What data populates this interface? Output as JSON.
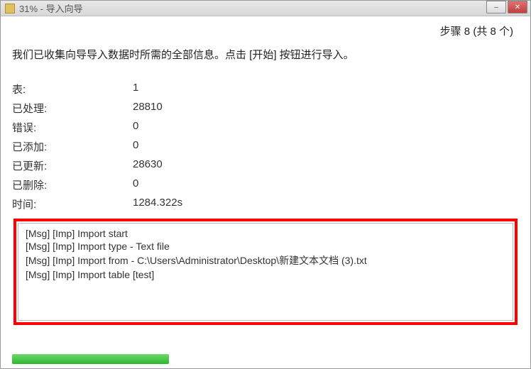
{
  "titlebar": {
    "title": "31% - 导入向导"
  },
  "step": {
    "label": "步骤 8 (共 8 个)"
  },
  "description": "我们已收集向导导入数据时所需的全部信息。点击 [开始] 按钮进行导入。",
  "stats": {
    "tables_label": "表:",
    "tables_value": "1",
    "processed_label": "已处理:",
    "processed_value": "28810",
    "errors_label": "错误:",
    "errors_value": "0",
    "added_label": "已添加:",
    "added_value": "0",
    "updated_label": "已更新:",
    "updated_value": "28630",
    "deleted_label": "已删除:",
    "deleted_value": "0",
    "time_label": "时间:",
    "time_value": "1284.322s"
  },
  "log": {
    "lines": [
      "[Msg] [Imp] Import start",
      "[Msg] [Imp] Import type - Text file",
      "[Msg] [Imp] Import from - C:\\Users\\Administrator\\Desktop\\新建文本文档 (3).txt",
      "[Msg] [Imp] Import table [test]"
    ]
  },
  "progress": {
    "percent": 31
  }
}
